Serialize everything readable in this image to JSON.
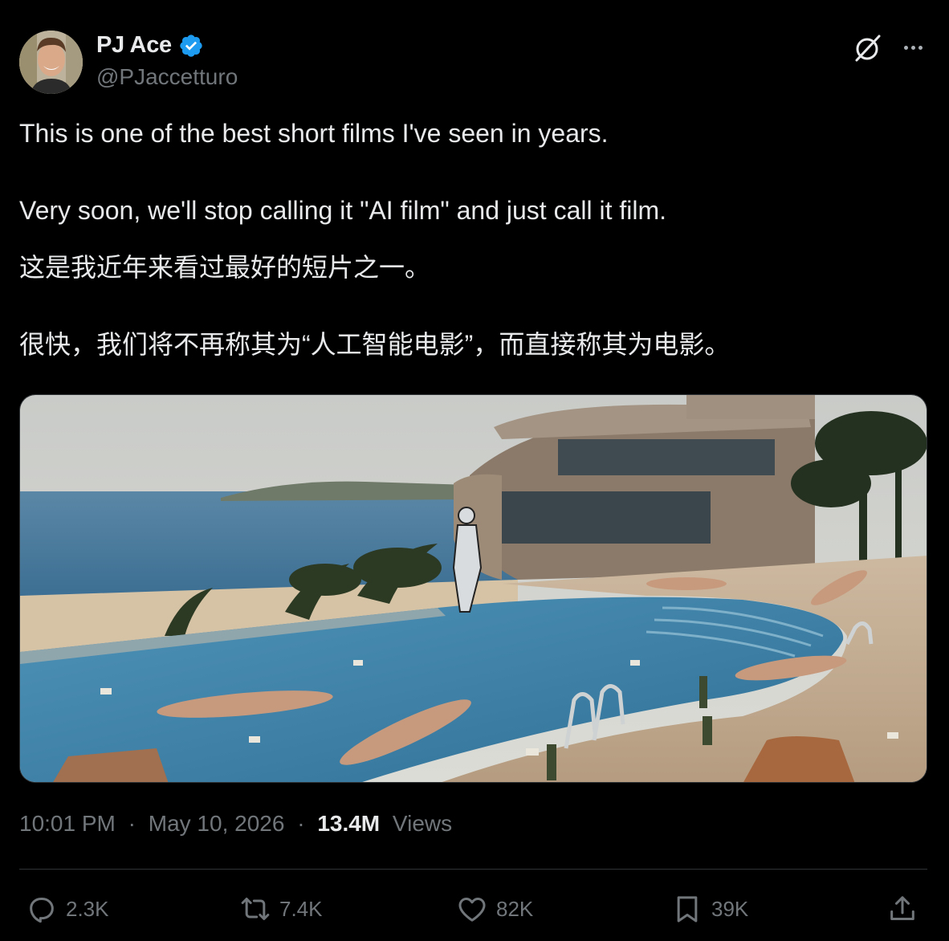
{
  "author": {
    "display_name": "PJ Ace",
    "handle": "@PJaccetturo",
    "verified": true,
    "verified_color": "#1d9bf0"
  },
  "header_actions": {
    "grok_icon": "grok-icon",
    "more_icon": "more-icon"
  },
  "tweet": {
    "line1": "This is one of the best short films I've seen in years.",
    "line2": "Very soon, we'll stop calling it \"AI film\" and just call it film.",
    "line3": "这是我近年来看过最好的短片之一。",
    "line4": "很快，我们将不再称其为“人工智能电影”，而直接称其为电影。"
  },
  "meta": {
    "time": "10:01 PM",
    "separator": "·",
    "date": "May 10, 2026",
    "views_count": "13.4M",
    "views_label": "Views"
  },
  "actions": {
    "reply": "2.3K",
    "retweet": "7.4K",
    "like": "82K",
    "bookmark": "39K"
  },
  "colors": {
    "background": "#000000",
    "text": "#e7e9ea",
    "secondary": "#71767b",
    "border": "#2f3336"
  }
}
